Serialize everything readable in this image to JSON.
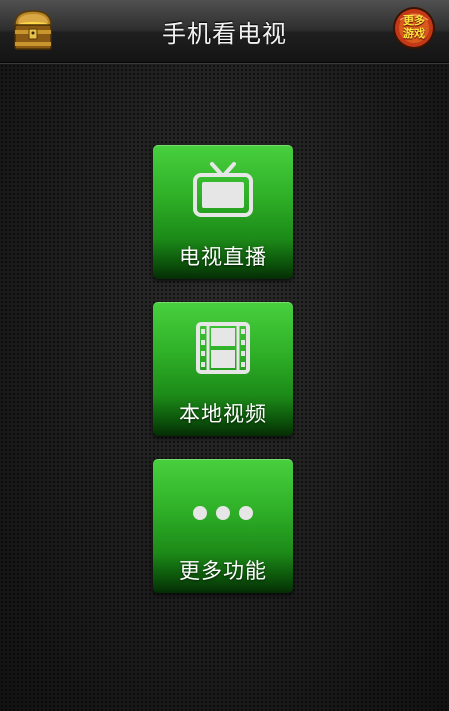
{
  "header": {
    "title": "手机看电视",
    "more_games_label": "更多游戏",
    "left_icon": "treasure-chest-icon"
  },
  "tiles": [
    {
      "label": "电视直播",
      "icon": "tv-icon"
    },
    {
      "label": "本地视频",
      "icon": "film-icon"
    },
    {
      "label": "更多功能",
      "icon": "more-dots-icon"
    }
  ],
  "colors": {
    "tile_green": "#2fb028",
    "topbar": "#2e2e2e",
    "background": "#1b1b1b",
    "badge_yellow": "#ffe640"
  }
}
